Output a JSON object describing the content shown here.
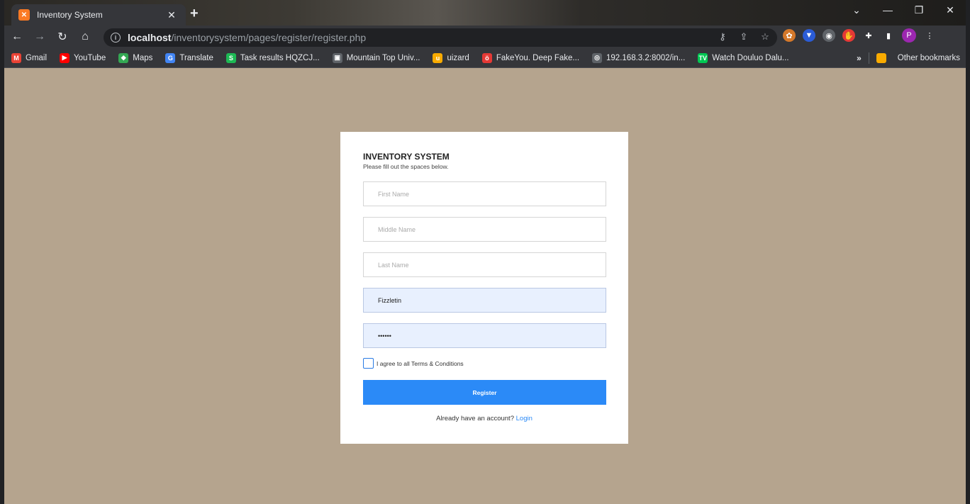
{
  "browser": {
    "tab_title": "Inventory System",
    "tab_favicon_text": "✕",
    "url_host": "localhost",
    "url_path": "/inventorysystem/pages/register/register.php",
    "profile_initial": "P"
  },
  "bookmarks": [
    {
      "label": "Gmail",
      "icon_color": "#ea4335",
      "icon_text": "M"
    },
    {
      "label": "YouTube",
      "icon_color": "#ff0000",
      "icon_text": "▶"
    },
    {
      "label": "Maps",
      "icon_color": "#34a853",
      "icon_text": "◆"
    },
    {
      "label": "Translate",
      "icon_color": "#4285f4",
      "icon_text": "G"
    },
    {
      "label": "Task results HQZCJ...",
      "icon_color": "#1db954",
      "icon_text": "S"
    },
    {
      "label": "Mountain Top Univ...",
      "icon_color": "#5f6368",
      "icon_text": "▣"
    },
    {
      "label": "uizard",
      "icon_color": "#f9ab00",
      "icon_text": "u"
    },
    {
      "label": "FakeYou. Deep Fake...",
      "icon_color": "#e53935",
      "icon_text": "ö"
    },
    {
      "label": "192.168.3.2:8002/in...",
      "icon_color": "#5f6368",
      "icon_text": "◎"
    },
    {
      "label": "Watch Douluo Dalu...",
      "icon_color": "#00c853",
      "icon_text": "TV"
    }
  ],
  "bookmarks_more": "»",
  "other_bookmarks": "Other bookmarks",
  "form": {
    "title": "INVENTORY SYSTEM",
    "subtitle": "Please fill out the spaces below.",
    "first_name_placeholder": "First Name",
    "middle_name_placeholder": "Middle Name",
    "last_name_placeholder": "Last Name",
    "username_value": "Fizzletin",
    "password_value": "••••••",
    "terms_label": "I agree to all Terms & Conditions",
    "register_label": "Register",
    "footer_text": "Already have an account?",
    "login_label": "Login"
  }
}
